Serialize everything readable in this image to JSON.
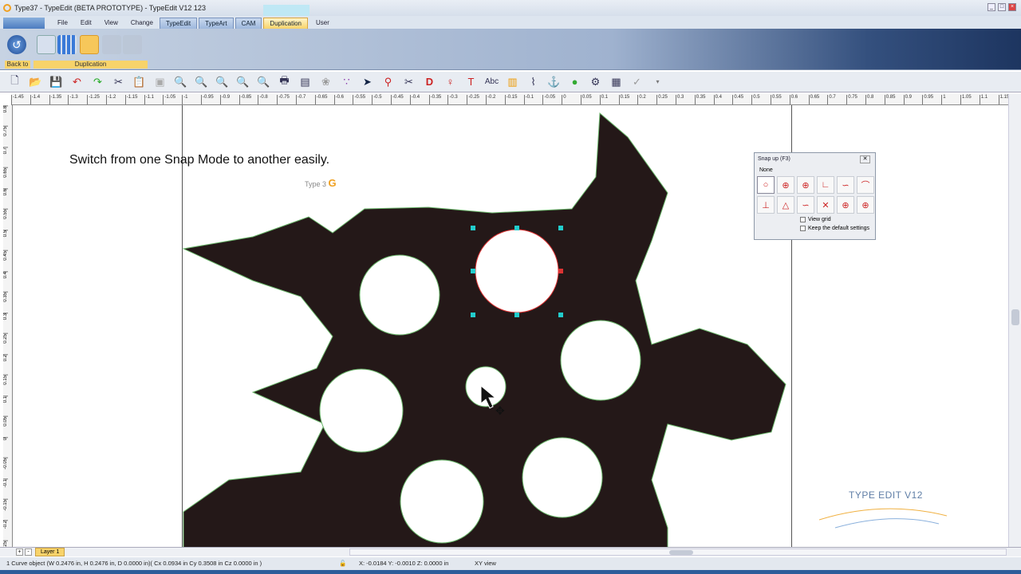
{
  "window": {
    "title": "Type37 - TypeEdit (BETA PROTOTYPE) - TypeEdit V12 123"
  },
  "menu": {
    "items": [
      "File",
      "Edit",
      "View",
      "Change"
    ],
    "tabs": [
      "TypeEdit",
      "TypeArt",
      "CAM",
      "Duplication"
    ],
    "active_tab": "Duplication",
    "user": "User"
  },
  "ribbon": {
    "back_label": "Back to",
    "group_label": "Duplication"
  },
  "toolbar": {
    "text_tool": "Abc"
  },
  "rulers": {
    "h": [
      "-1.45",
      "-1.4",
      "-1.35",
      "-1.3",
      "-1.25",
      "-1.2",
      "-1.15",
      "-1.1",
      "-1.05",
      "-1",
      "-0.95",
      "-0.9",
      "-0.85",
      "-0.8",
      "-0.75",
      "-0.7",
      "-0.65",
      "-0.6",
      "-0.55",
      "-0.5",
      "-0.45",
      "-0.4",
      "-0.35",
      "-0.3",
      "-0.25",
      "-0.2",
      "-0.15",
      "-0.1",
      "-0.05",
      "0",
      "0.05",
      "0.1",
      "0.15",
      "0.2",
      "0.25",
      "0.3",
      "0.35",
      "0.4",
      "0.45",
      "0.5",
      "0.55",
      "0.6",
      "0.65",
      "0.7",
      "0.75",
      "0.8",
      "0.85",
      "0.9",
      "0.95",
      "1",
      "1.05",
      "1.1",
      "1.15"
    ],
    "v": [
      "0.8",
      "0.75",
      "0.7",
      "0.65",
      "0.6",
      "0.55",
      "0.5",
      "0.45",
      "0.4",
      "0.35",
      "0.3",
      "0.25",
      "0.2",
      "0.15",
      "0.1",
      "0.05",
      "0",
      "-0.05",
      "-0.1",
      "-0.15",
      "-0.2",
      "-0.25"
    ]
  },
  "canvas": {
    "caption": "Switch from one Snap Mode to another easily.",
    "logo_text": "Type 3",
    "watermark": "TYPE EDIT V12"
  },
  "snap_panel": {
    "title": "Snap up (F3)",
    "none_label": "None",
    "view_grid": "View grid",
    "keep_defaults": "Keep the default settings",
    "view_grid_checked": false,
    "keep_defaults_checked": false
  },
  "layers": {
    "add": "+",
    "remove": "-",
    "active": "Layer 1"
  },
  "status": {
    "selection": "1 Curve object (W 0.2476 in, H 0.2476 in, D 0.0000 in)( Cx 0.0934 in  Cy 0.3508 in  Cz 0.0000 in )",
    "coords": "X: -0.0184   Y: -0.0010   Z: 0.0000 in",
    "view": "XY view"
  }
}
